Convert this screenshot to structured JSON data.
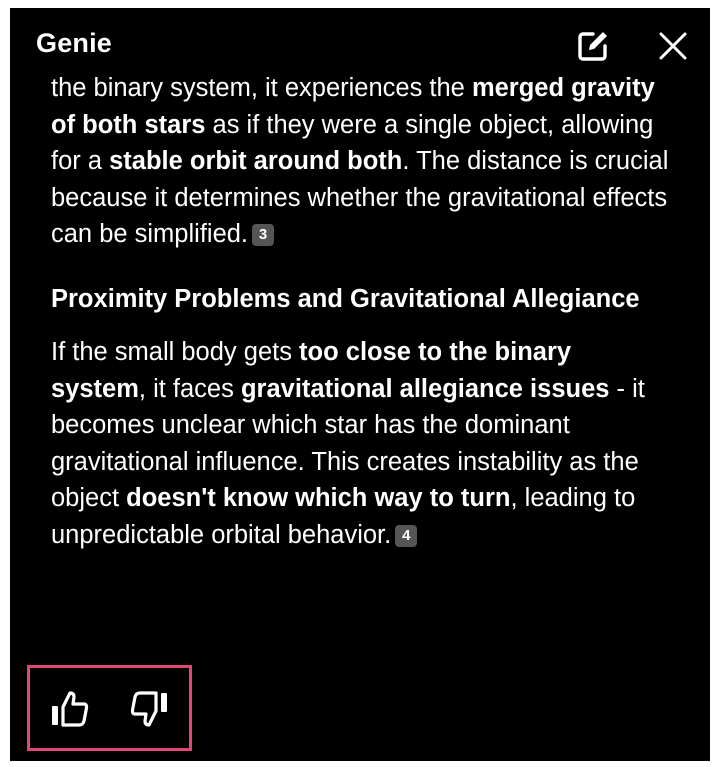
{
  "header": {
    "title": "Genie",
    "edit_icon": "edit-icon",
    "close_icon": "close-icon"
  },
  "content": {
    "p1": {
      "t1": "the binary system, it experiences the ",
      "b1": "merged gravity of both stars",
      "t2": " as if they were a single object, allowing for a ",
      "b2": "stable orbit around both",
      "t3": ". The distance is crucial because it determines whether the gravitational effects can be simplified.",
      "cite": "3"
    },
    "heading": "Proximity Problems and Gravitational Allegiance",
    "p2": {
      "t1": "If the small body gets ",
      "b1": "too close to the binary system",
      "t2": ", it faces ",
      "b2": "gravitational allegiance issues",
      "t3": " - it becomes unclear which star has the dominant gravitational influence. This creates instability as the object ",
      "b3": "doesn't know which way to turn",
      "t4": ", leading to unpredictable orbital behavior.",
      "cite": "4"
    }
  },
  "feedback": {
    "thumbs_up_icon": "thumbs-up-icon",
    "thumbs_down_icon": "thumbs-down-icon",
    "highlight_color": "#e0467c"
  }
}
